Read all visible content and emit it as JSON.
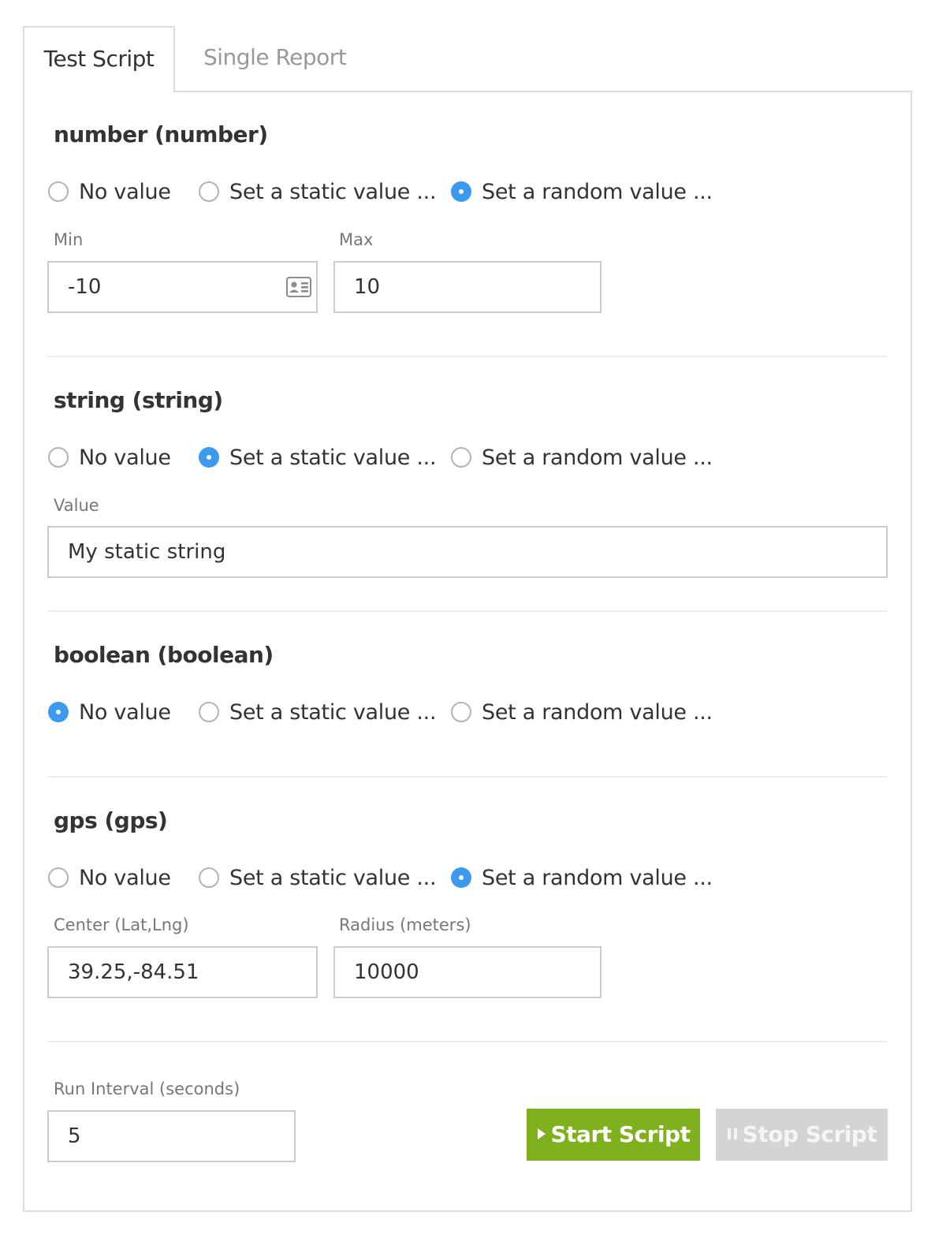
{
  "tabs": [
    {
      "label": "Test Script",
      "active": true
    },
    {
      "label": "Single Report",
      "active": false
    }
  ],
  "sections": {
    "number": {
      "title": "number (number)",
      "options": [
        "No value",
        "Set a static value ...",
        "Set a random value ..."
      ],
      "selected": "Set a random value ...",
      "min_label": "Min",
      "min_value": "-10",
      "max_label": "Max",
      "max_value": "10"
    },
    "string": {
      "title": "string (string)",
      "options": [
        "No value",
        "Set a static value ...",
        "Set a random value ..."
      ],
      "selected": "Set a static value ...",
      "value_label": "Value",
      "value": "My static string"
    },
    "boolean": {
      "title": "boolean (boolean)",
      "options": [
        "No value",
        "Set a static value ...",
        "Set a random value ..."
      ],
      "selected": "No value"
    },
    "gps": {
      "title": "gps (gps)",
      "options": [
        "No value",
        "Set a static value ...",
        "Set a random value ..."
      ],
      "selected": "Set a random value ...",
      "center_label": "Center (Lat,Lng)",
      "center_value": "39.25,-84.51",
      "radius_label": "Radius (meters)",
      "radius_value": "10000"
    }
  },
  "run_interval": {
    "label": "Run Interval (seconds)",
    "value": "5"
  },
  "buttons": {
    "start": "Start Script",
    "stop": "Stop Script"
  },
  "colors": {
    "accent_radio": "#3b99f0",
    "start_button": "#7fb11e",
    "stop_button_disabled": "#d4d4d4"
  },
  "icons": {
    "contact_card": "contact-card-icon",
    "play": "play-icon",
    "pause": "pause-icon"
  }
}
